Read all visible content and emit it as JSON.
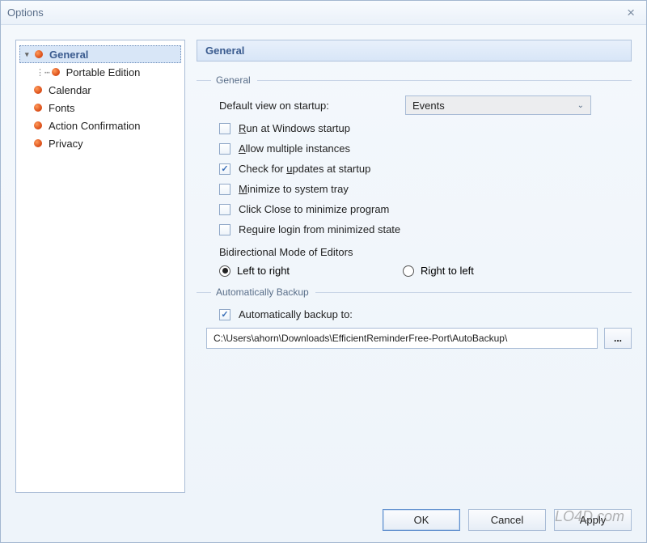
{
  "window": {
    "title": "Options",
    "close_glyph": "×"
  },
  "sidebar": {
    "items": [
      {
        "label": "General",
        "selected": true
      },
      {
        "label": "Portable Edition",
        "child": true
      },
      {
        "label": "Calendar"
      },
      {
        "label": "Fonts"
      },
      {
        "label": "Action Confirmation"
      },
      {
        "label": "Privacy"
      }
    ]
  },
  "panel": {
    "heading": "General",
    "group_general": "General",
    "default_view_label": "Default view on startup:",
    "default_view_value": "Events",
    "chk_run_startup": {
      "label": "Run at Windows startup",
      "checked": false,
      "mn": "R"
    },
    "chk_allow_multi": {
      "label": "Allow multiple instances",
      "checked": false,
      "mn": "A"
    },
    "chk_updates": {
      "label": "Check for updates at startup",
      "checked": true,
      "mn": "u"
    },
    "chk_minimize_tray": {
      "label": "Minimize to system tray",
      "checked": false,
      "mn": "M"
    },
    "chk_click_close": {
      "label": "Click Close to minimize program",
      "checked": false
    },
    "chk_require_login": {
      "label": "Require login from minimized state",
      "checked": false,
      "mn": "q"
    },
    "bidi_label": "Bidirectional Mode of Editors",
    "radio_ltr": "Left to right",
    "radio_rtl": "Right to left",
    "radio_selected": "ltr",
    "group_backup": "Automatically Backup",
    "chk_auto_backup": {
      "label": "Automatically backup to:",
      "checked": true
    },
    "backup_path": "C:\\Users\\ahorn\\Downloads\\EfficientReminderFree-Port\\AutoBackup\\",
    "browse_label": "..."
  },
  "buttons": {
    "ok": "OK",
    "cancel": "Cancel",
    "apply": "Apply"
  },
  "watermark": "LO4D.com"
}
